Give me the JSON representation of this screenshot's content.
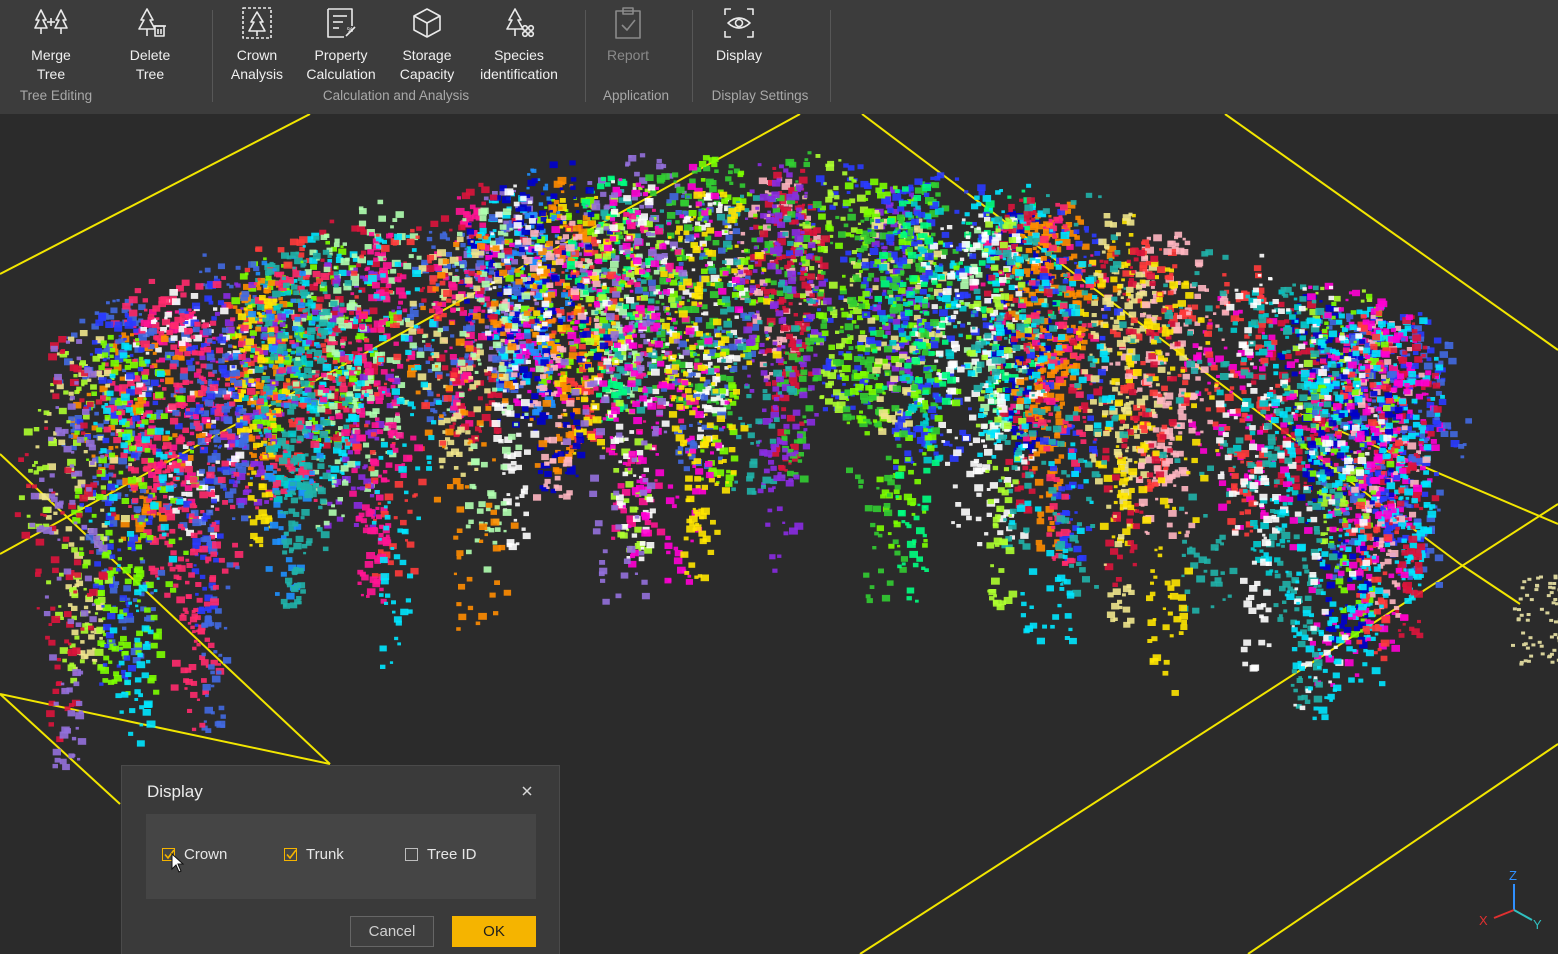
{
  "ribbon": {
    "groups": [
      {
        "label": "Tree Editing",
        "tools": [
          {
            "label": "Merge Tree",
            "icon": "merge-tree-icon"
          },
          {
            "label": "Delete Tree",
            "icon": "delete-tree-icon"
          }
        ]
      },
      {
        "label": "Calculation and Analysis",
        "tools": [
          {
            "label": "Crown\nAnalysis",
            "icon": "crown-analysis-icon"
          },
          {
            "label": "Property\nCalculation",
            "icon": "property-calculation-icon"
          },
          {
            "label": "Storage\nCapacity",
            "icon": "storage-capacity-icon"
          },
          {
            "label": "Species\nidentification",
            "icon": "species-identification-icon"
          }
        ]
      },
      {
        "label": "Application",
        "tools": [
          {
            "label": "Report",
            "icon": "report-icon",
            "disabled": true
          }
        ]
      },
      {
        "label": "Display Settings",
        "tools": [
          {
            "label": "Display",
            "icon": "display-eye-icon"
          }
        ]
      }
    ]
  },
  "viewport": {
    "grid_color": "#f2e600",
    "background": "#2b2b2b",
    "point_cloud": "segmented forest point cloud, one color per tree"
  },
  "gizmo": {
    "x": "X",
    "y": "Y",
    "z": "Z",
    "x_color": "#e03030",
    "y_color": "#30c0c0",
    "z_color": "#3090ff"
  },
  "dialog": {
    "title": "Display",
    "options": [
      {
        "label": "Crown",
        "checked": true
      },
      {
        "label": "Trunk",
        "checked": true
      },
      {
        "label": "Tree ID",
        "checked": false
      }
    ],
    "cancel": "Cancel",
    "ok": "OK",
    "accent": "#f5b400"
  }
}
